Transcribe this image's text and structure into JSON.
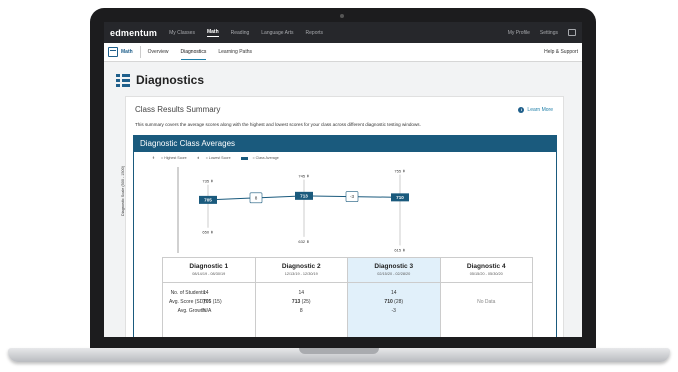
{
  "nav": {
    "logo": "edmentum",
    "items": [
      "My Classes",
      "Math",
      "Reading",
      "Language Arts",
      "Reports"
    ],
    "active": "Math",
    "profile": "My Profile",
    "settings": "Settings"
  },
  "subnav": {
    "subject": "Math",
    "tabs": [
      "Overview",
      "Diagnostics",
      "Learning Paths"
    ],
    "active_tab": "Diagnostics",
    "help": "Help & Support"
  },
  "page": {
    "title": "Diagnostics"
  },
  "summary": {
    "title": "Class Results Summary",
    "learn_more": "Learn More",
    "description": "This summary covers the average scores along with the highest and lowest scores for your class across different diagnostic testing windows."
  },
  "panel": {
    "title": "Diagnostic Class Averages",
    "legend": {
      "high": "= Highest Score",
      "low": "= Lowest Score",
      "avg": "= Class Average"
    },
    "ylabel": "Diagnostic Scale (500 - 1500)"
  },
  "chart_data": {
    "type": "line",
    "categories": [
      "Diagnostic 1",
      "Diagnostic 2",
      "Diagnostic 3"
    ],
    "averages": [
      705,
      713,
      710
    ],
    "highest": [
      735,
      745,
      755
    ],
    "lowest": [
      650,
      632,
      615
    ],
    "growth_labels": [
      "8",
      "-3"
    ],
    "ylim": [
      600,
      770
    ]
  },
  "table": {
    "row_labels": {
      "students": "No. of Students:",
      "avg": "Avg. Score (SD):",
      "growth": "Avg. Growth:"
    },
    "columns": [
      {
        "name": "Diagnostic 1",
        "dates": "08/14/19 - 08/30/19",
        "students": "14",
        "avg": "705",
        "sd": "(15)",
        "growth": "N/A"
      },
      {
        "name": "Diagnostic 2",
        "dates": "12/13/19 - 12/30/19",
        "students": "14",
        "avg": "713",
        "sd": "(25)",
        "growth": "8"
      },
      {
        "name": "Diagnostic 3",
        "dates": "02/15/20 - 02/28/20",
        "students": "14",
        "avg": "710",
        "sd": "(28)",
        "growth": "-3"
      },
      {
        "name": "Diagnostic 4",
        "dates": "05/15/20 - 05/30/20",
        "no_data": "No Data"
      }
    ]
  }
}
